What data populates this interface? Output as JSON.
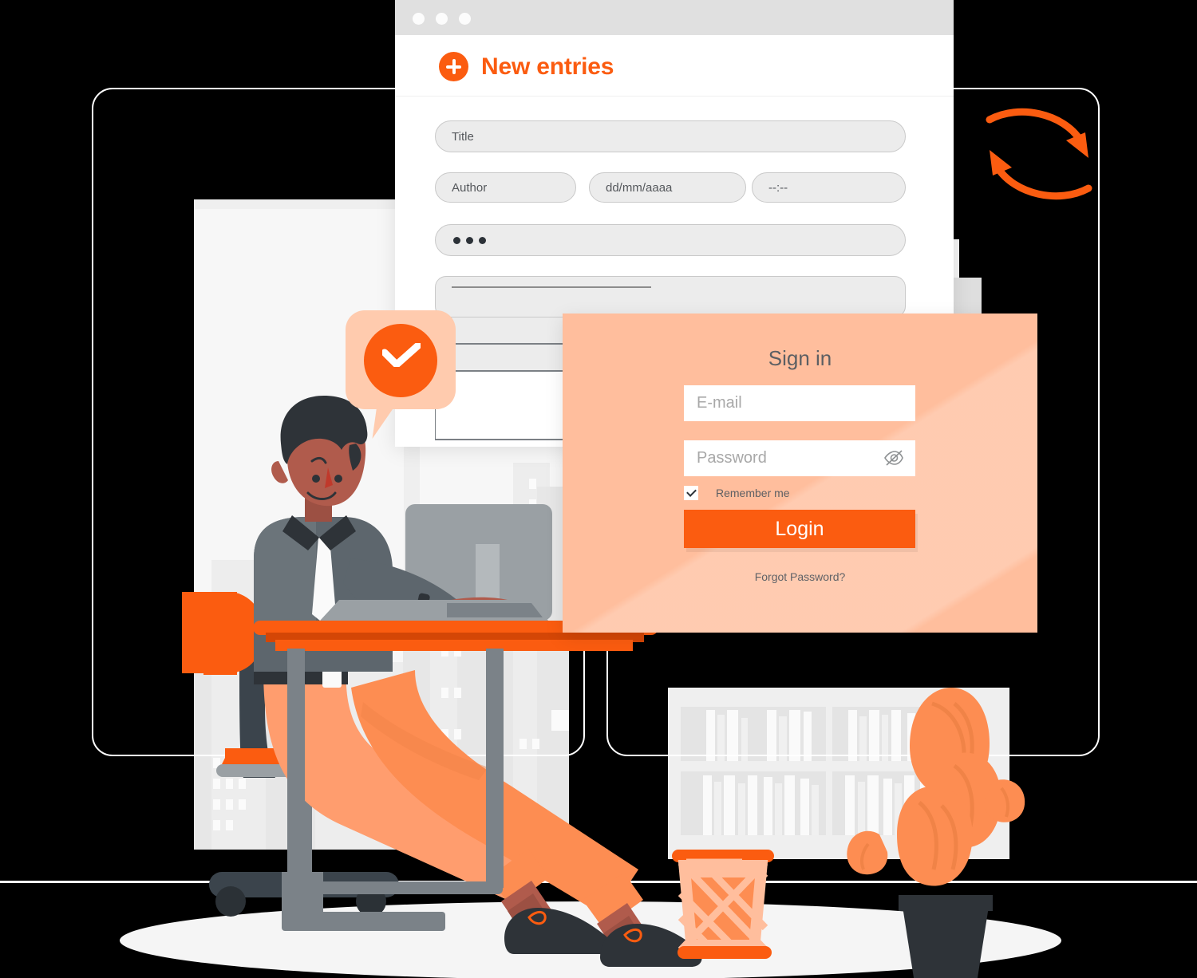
{
  "illustration": {
    "title": "Sign in / New entries illustration",
    "accent_color": "#fb5c10",
    "accent_light": "#ffbe9d",
    "accent_pale": "#ffcbae",
    "dark_color": "#2e3338",
    "grey_color": "#6e7478",
    "skin_color": "#b05b4c",
    "wall_color": "#efefef"
  },
  "frames": {
    "left_label": "decorative-frame-left",
    "right_label": "decorative-frame-right"
  },
  "sync_icon": {
    "name": "sync-arrows-icon"
  },
  "browser": {
    "traffic_lights": [
      "close",
      "minimize",
      "maximize"
    ],
    "header": {
      "add_icon": "plus-circle-icon",
      "title": "New entries"
    },
    "fields": [
      {
        "name": "title-input",
        "placeholder": "Title",
        "value": ""
      },
      {
        "name": "author-input",
        "placeholder": "Author",
        "value": ""
      },
      {
        "name": "date-input",
        "placeholder": "dd/mm/aaaa",
        "value": ""
      },
      {
        "name": "time-input",
        "placeholder": "--:--",
        "value": ""
      },
      {
        "name": "options-input",
        "placeholder": "•••",
        "value": ""
      }
    ],
    "textarea": {
      "name": "body-textarea",
      "placeholder": ""
    },
    "list_rows": 3
  },
  "notification": {
    "icon": "check-circle-icon",
    "label": "success-check-bubble"
  },
  "signin": {
    "title": "Sign in",
    "email": {
      "placeholder": "E-mail",
      "value": ""
    },
    "password": {
      "placeholder": "Password",
      "value": "",
      "toggle_icon": "eye-off-icon"
    },
    "remember": {
      "label": "Remember me",
      "checked": true
    },
    "login_label": "Login",
    "forgot_label": "Forgot Password?"
  },
  "scene": {
    "person": "man-working-at-desk",
    "desk": "orange-desk",
    "chair": "office-chair",
    "monitor": "desktop-monitor",
    "keyboard": "keyboard",
    "bookshelf": "bookshelf",
    "wastebasket": "mesh-wastebasket",
    "plant": "potted-cactus",
    "window_wall": "office-window-with-city-skyline"
  }
}
